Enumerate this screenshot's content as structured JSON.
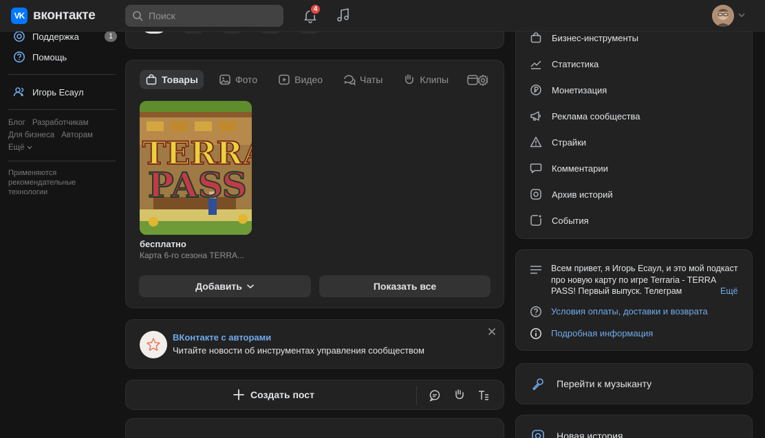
{
  "header": {
    "logo_mark": "VK",
    "logo_text": "вконтакте",
    "search_placeholder": "Поиск",
    "notification_count": "4"
  },
  "sidebar": {
    "items": [
      {
        "label": "Поддержка",
        "icon": "support-icon",
        "badge": "1"
      },
      {
        "label": "Помощь",
        "icon": "help-icon"
      }
    ],
    "profile_item": {
      "label": "Игорь Есаул",
      "icon": "users-icon"
    },
    "footer_links": [
      "Блог",
      "Разработчикам",
      "Для бизнеса",
      "Авторам",
      "Ещё"
    ],
    "recommendation_note": "Применяются рекомендательные технологии"
  },
  "media_tabs": [
    {
      "label": "Товары",
      "icon": "bag-icon",
      "active": true
    },
    {
      "label": "Фото",
      "icon": "image-icon"
    },
    {
      "label": "Видео",
      "icon": "video-icon"
    },
    {
      "label": "Чаты",
      "icon": "chat-icon"
    },
    {
      "label": "Клипы",
      "icon": "clip-icon"
    }
  ],
  "product": {
    "price": "бесплатно",
    "title": "Карта 6-го сезона TERRA...",
    "image_word1": "TERRA",
    "image_word2": "PASS"
  },
  "product_actions": {
    "add_label": "Добавить",
    "show_all_label": "Показать все"
  },
  "promo": {
    "title": "ВКонтакте с авторами",
    "subtitle": "Читайте новости об инструментах управления сообществом"
  },
  "composer": {
    "create_post_label": "Создать пост"
  },
  "right_menu": [
    {
      "label": "Бизнес-инструменты",
      "icon": "briefcase-icon"
    },
    {
      "label": "Статистика",
      "icon": "stats-icon"
    },
    {
      "label": "Монетизация",
      "icon": "ruble-icon"
    },
    {
      "label": "Реклама сообщества",
      "icon": "megaphone-icon"
    },
    {
      "label": "Страйки",
      "icon": "warning-icon"
    },
    {
      "label": "Комментарии",
      "icon": "comment-icon"
    },
    {
      "label": "Архив историй",
      "icon": "archive-icon"
    },
    {
      "label": "События",
      "icon": "event-icon"
    }
  ],
  "about": {
    "description": "Всем привет, я Игорь Есаул, и это мой подкаст про новую карту по игре Terraria - TERRA PASS! Первый выпуск. Телеграм",
    "more_label": "Ещё",
    "terms_link": "Условия оплаты, доставки и возврата",
    "info_link": "Подробная информация"
  },
  "musician": {
    "label": "Перейти к музыканту"
  },
  "story": {
    "label": "Новая история"
  },
  "colors": {
    "accent": "#71aaeb",
    "badge": "#e64646",
    "background": "#141414",
    "card": "#222222"
  }
}
